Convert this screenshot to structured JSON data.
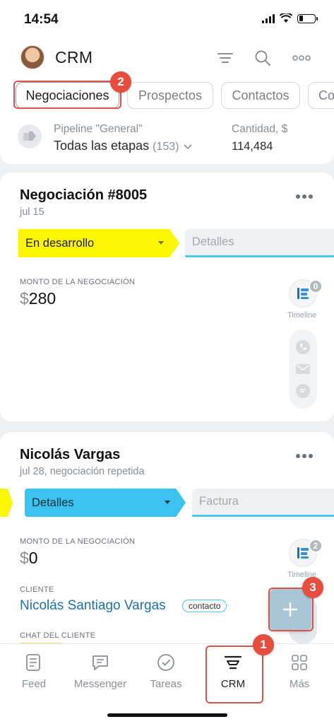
{
  "status_bar": {
    "time": "14:54"
  },
  "header": {
    "title": "CRM",
    "tabs": [
      "Negociaciones",
      "Prospectos",
      "Contactos",
      "Co"
    ],
    "pipeline": {
      "label": "Pipeline \"General\"",
      "value": "Todas las etapas",
      "count": "(153)"
    },
    "quantity": {
      "label": "Cantidad, $",
      "value": "114,484"
    }
  },
  "cards": [
    {
      "title": "Negociación #8005",
      "subtitle": "jul 15",
      "stage": "En desarrollo",
      "next_stage": "Detalles",
      "amount_label": "MONTO DE LA NEGOCIACIÓN",
      "currency": "$",
      "amount": "280",
      "timeline_count": "0",
      "timeline_label": "Timeline"
    },
    {
      "title": "Nicolás Vargas",
      "subtitle": "jul 28, negociación repetida",
      "stage": "Detalles",
      "next_stage": "Factura",
      "amount_label": "MONTO DE LA NEGOCIACIÓN",
      "currency": "$",
      "amount": "0",
      "timeline_count": "2",
      "timeline_label": "Timeline",
      "client_label": "CLIENTE",
      "client_name": "Nicolás Santiago Vargas",
      "client_tag": "contacto",
      "chat_label": "CHAT DEL CLIENTE"
    }
  ],
  "annotations": {
    "badge_1": "1",
    "badge_2": "2",
    "badge_3": "3"
  },
  "bottom_nav": [
    {
      "label": "Feed",
      "icon": "feed-icon"
    },
    {
      "label": "Messenger",
      "icon": "messenger-icon"
    },
    {
      "label": "Tareas",
      "icon": "tasks-icon"
    },
    {
      "label": "CRM",
      "icon": "crm-icon"
    },
    {
      "label": "Más",
      "icon": "grid-icon"
    }
  ],
  "colors": {
    "stage_yellow": "#fbf700",
    "stage_blue": "#3ac3ee",
    "annotation_red": "#e74c3c",
    "link_blue": "#1f6fb2"
  }
}
